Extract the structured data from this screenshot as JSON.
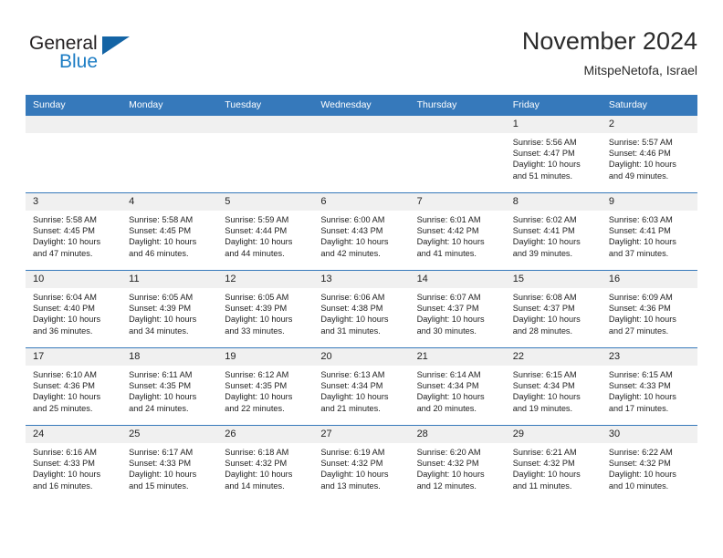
{
  "brand": {
    "word_one": "General",
    "word_two": "Blue",
    "flag_icon": "blue-triangle-flag"
  },
  "header": {
    "title": "November 2024",
    "subtitle": "MitspeNetofa, Israel"
  },
  "colors": {
    "header_blue": "#3679bb",
    "daynum_gray": "#f0f0f0",
    "brand_blue": "#1d7dc4",
    "text": "#222222"
  },
  "calendar": {
    "weekday_headers": [
      "Sunday",
      "Monday",
      "Tuesday",
      "Wednesday",
      "Thursday",
      "Friday",
      "Saturday"
    ],
    "weeks": [
      [
        {
          "day": "",
          "sunrise": "",
          "sunset": "",
          "daylight_line1": "",
          "daylight_line2": ""
        },
        {
          "day": "",
          "sunrise": "",
          "sunset": "",
          "daylight_line1": "",
          "daylight_line2": ""
        },
        {
          "day": "",
          "sunrise": "",
          "sunset": "",
          "daylight_line1": "",
          "daylight_line2": ""
        },
        {
          "day": "",
          "sunrise": "",
          "sunset": "",
          "daylight_line1": "",
          "daylight_line2": ""
        },
        {
          "day": "",
          "sunrise": "",
          "sunset": "",
          "daylight_line1": "",
          "daylight_line2": ""
        },
        {
          "day": "1",
          "sunrise": "Sunrise: 5:56 AM",
          "sunset": "Sunset: 4:47 PM",
          "daylight_line1": "Daylight: 10 hours",
          "daylight_line2": "and 51 minutes."
        },
        {
          "day": "2",
          "sunrise": "Sunrise: 5:57 AM",
          "sunset": "Sunset: 4:46 PM",
          "daylight_line1": "Daylight: 10 hours",
          "daylight_line2": "and 49 minutes."
        }
      ],
      [
        {
          "day": "3",
          "sunrise": "Sunrise: 5:58 AM",
          "sunset": "Sunset: 4:45 PM",
          "daylight_line1": "Daylight: 10 hours",
          "daylight_line2": "and 47 minutes."
        },
        {
          "day": "4",
          "sunrise": "Sunrise: 5:58 AM",
          "sunset": "Sunset: 4:45 PM",
          "daylight_line1": "Daylight: 10 hours",
          "daylight_line2": "and 46 minutes."
        },
        {
          "day": "5",
          "sunrise": "Sunrise: 5:59 AM",
          "sunset": "Sunset: 4:44 PM",
          "daylight_line1": "Daylight: 10 hours",
          "daylight_line2": "and 44 minutes."
        },
        {
          "day": "6",
          "sunrise": "Sunrise: 6:00 AM",
          "sunset": "Sunset: 4:43 PM",
          "daylight_line1": "Daylight: 10 hours",
          "daylight_line2": "and 42 minutes."
        },
        {
          "day": "7",
          "sunrise": "Sunrise: 6:01 AM",
          "sunset": "Sunset: 4:42 PM",
          "daylight_line1": "Daylight: 10 hours",
          "daylight_line2": "and 41 minutes."
        },
        {
          "day": "8",
          "sunrise": "Sunrise: 6:02 AM",
          "sunset": "Sunset: 4:41 PM",
          "daylight_line1": "Daylight: 10 hours",
          "daylight_line2": "and 39 minutes."
        },
        {
          "day": "9",
          "sunrise": "Sunrise: 6:03 AM",
          "sunset": "Sunset: 4:41 PM",
          "daylight_line1": "Daylight: 10 hours",
          "daylight_line2": "and 37 minutes."
        }
      ],
      [
        {
          "day": "10",
          "sunrise": "Sunrise: 6:04 AM",
          "sunset": "Sunset: 4:40 PM",
          "daylight_line1": "Daylight: 10 hours",
          "daylight_line2": "and 36 minutes."
        },
        {
          "day": "11",
          "sunrise": "Sunrise: 6:05 AM",
          "sunset": "Sunset: 4:39 PM",
          "daylight_line1": "Daylight: 10 hours",
          "daylight_line2": "and 34 minutes."
        },
        {
          "day": "12",
          "sunrise": "Sunrise: 6:05 AM",
          "sunset": "Sunset: 4:39 PM",
          "daylight_line1": "Daylight: 10 hours",
          "daylight_line2": "and 33 minutes."
        },
        {
          "day": "13",
          "sunrise": "Sunrise: 6:06 AM",
          "sunset": "Sunset: 4:38 PM",
          "daylight_line1": "Daylight: 10 hours",
          "daylight_line2": "and 31 minutes."
        },
        {
          "day": "14",
          "sunrise": "Sunrise: 6:07 AM",
          "sunset": "Sunset: 4:37 PM",
          "daylight_line1": "Daylight: 10 hours",
          "daylight_line2": "and 30 minutes."
        },
        {
          "day": "15",
          "sunrise": "Sunrise: 6:08 AM",
          "sunset": "Sunset: 4:37 PM",
          "daylight_line1": "Daylight: 10 hours",
          "daylight_line2": "and 28 minutes."
        },
        {
          "day": "16",
          "sunrise": "Sunrise: 6:09 AM",
          "sunset": "Sunset: 4:36 PM",
          "daylight_line1": "Daylight: 10 hours",
          "daylight_line2": "and 27 minutes."
        }
      ],
      [
        {
          "day": "17",
          "sunrise": "Sunrise: 6:10 AM",
          "sunset": "Sunset: 4:36 PM",
          "daylight_line1": "Daylight: 10 hours",
          "daylight_line2": "and 25 minutes."
        },
        {
          "day": "18",
          "sunrise": "Sunrise: 6:11 AM",
          "sunset": "Sunset: 4:35 PM",
          "daylight_line1": "Daylight: 10 hours",
          "daylight_line2": "and 24 minutes."
        },
        {
          "day": "19",
          "sunrise": "Sunrise: 6:12 AM",
          "sunset": "Sunset: 4:35 PM",
          "daylight_line1": "Daylight: 10 hours",
          "daylight_line2": "and 22 minutes."
        },
        {
          "day": "20",
          "sunrise": "Sunrise: 6:13 AM",
          "sunset": "Sunset: 4:34 PM",
          "daylight_line1": "Daylight: 10 hours",
          "daylight_line2": "and 21 minutes."
        },
        {
          "day": "21",
          "sunrise": "Sunrise: 6:14 AM",
          "sunset": "Sunset: 4:34 PM",
          "daylight_line1": "Daylight: 10 hours",
          "daylight_line2": "and 20 minutes."
        },
        {
          "day": "22",
          "sunrise": "Sunrise: 6:15 AM",
          "sunset": "Sunset: 4:34 PM",
          "daylight_line1": "Daylight: 10 hours",
          "daylight_line2": "and 19 minutes."
        },
        {
          "day": "23",
          "sunrise": "Sunrise: 6:15 AM",
          "sunset": "Sunset: 4:33 PM",
          "daylight_line1": "Daylight: 10 hours",
          "daylight_line2": "and 17 minutes."
        }
      ],
      [
        {
          "day": "24",
          "sunrise": "Sunrise: 6:16 AM",
          "sunset": "Sunset: 4:33 PM",
          "daylight_line1": "Daylight: 10 hours",
          "daylight_line2": "and 16 minutes."
        },
        {
          "day": "25",
          "sunrise": "Sunrise: 6:17 AM",
          "sunset": "Sunset: 4:33 PM",
          "daylight_line1": "Daylight: 10 hours",
          "daylight_line2": "and 15 minutes."
        },
        {
          "day": "26",
          "sunrise": "Sunrise: 6:18 AM",
          "sunset": "Sunset: 4:32 PM",
          "daylight_line1": "Daylight: 10 hours",
          "daylight_line2": "and 14 minutes."
        },
        {
          "day": "27",
          "sunrise": "Sunrise: 6:19 AM",
          "sunset": "Sunset: 4:32 PM",
          "daylight_line1": "Daylight: 10 hours",
          "daylight_line2": "and 13 minutes."
        },
        {
          "day": "28",
          "sunrise": "Sunrise: 6:20 AM",
          "sunset": "Sunset: 4:32 PM",
          "daylight_line1": "Daylight: 10 hours",
          "daylight_line2": "and 12 minutes."
        },
        {
          "day": "29",
          "sunrise": "Sunrise: 6:21 AM",
          "sunset": "Sunset: 4:32 PM",
          "daylight_line1": "Daylight: 10 hours",
          "daylight_line2": "and 11 minutes."
        },
        {
          "day": "30",
          "sunrise": "Sunrise: 6:22 AM",
          "sunset": "Sunset: 4:32 PM",
          "daylight_line1": "Daylight: 10 hours",
          "daylight_line2": "and 10 minutes."
        }
      ]
    ]
  }
}
